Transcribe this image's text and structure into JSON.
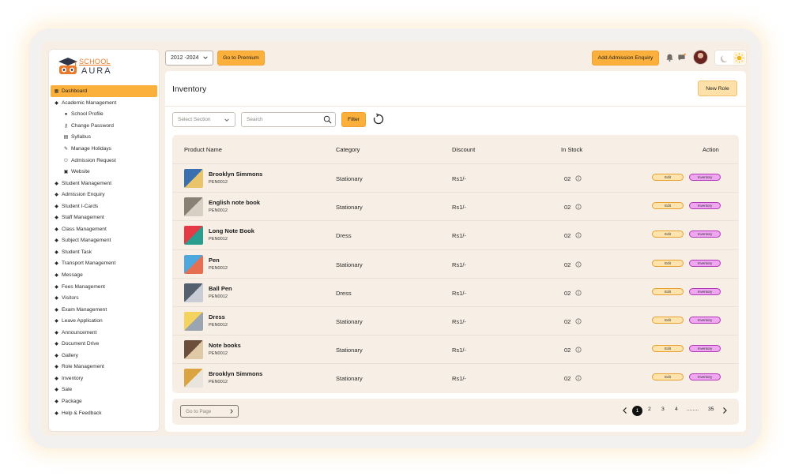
{
  "logo": {
    "line1": "SCHOOL",
    "line2": "AURA"
  },
  "sidebar": {
    "items": [
      {
        "label": "Dashboard",
        "icon": "dashboard-icon",
        "active": true
      },
      {
        "label": "Academic Management",
        "icon": "cap-icon"
      },
      {
        "label": "School Profile",
        "icon": "profile-icon",
        "sub": true
      },
      {
        "label": "Change Password",
        "icon": "key-icon",
        "sub": true
      },
      {
        "label": "Syllabus",
        "icon": "book-icon",
        "sub": true
      },
      {
        "label": "Manage Holidays",
        "icon": "pencil-icon",
        "sub": true
      },
      {
        "label": "Admission Request",
        "icon": "users-icon",
        "sub": true
      },
      {
        "label": "Website",
        "icon": "web-icon",
        "sub": true
      },
      {
        "label": "Student Management",
        "icon": "cap-icon"
      },
      {
        "label": "Admission Enquiry",
        "icon": "cap-icon"
      },
      {
        "label": "Student I-Cards",
        "icon": "cap-icon"
      },
      {
        "label": "Staff Management",
        "icon": "cap-icon"
      },
      {
        "label": "Class Management",
        "icon": "cap-icon"
      },
      {
        "label": "Subject Management",
        "icon": "cap-icon"
      },
      {
        "label": "Student Task",
        "icon": "cap-icon"
      },
      {
        "label": "Transport Management",
        "icon": "cap-icon"
      },
      {
        "label": "Message",
        "icon": "cap-icon"
      },
      {
        "label": "Fees Management",
        "icon": "cap-icon"
      },
      {
        "label": "Visitors",
        "icon": "cap-icon"
      },
      {
        "label": "Exam Management",
        "icon": "cap-icon"
      },
      {
        "label": "Leave Application",
        "icon": "cap-icon"
      },
      {
        "label": "Announcement",
        "icon": "cap-icon"
      },
      {
        "label": "Document Drive",
        "icon": "cap-icon"
      },
      {
        "label": "Gallery",
        "icon": "cap-icon"
      },
      {
        "label": "Role Management",
        "icon": "cap-icon"
      },
      {
        "label": "Inventory",
        "icon": "cap-icon"
      },
      {
        "label": "Sale",
        "icon": "cap-icon"
      },
      {
        "label": "Package",
        "icon": "cap-icon"
      },
      {
        "label": "Help & Feedback",
        "icon": "cap-icon"
      }
    ]
  },
  "topbar": {
    "year": "2012 -2024",
    "premium_label": "Go to Premium",
    "admission_label": "Add Admission Enquiry"
  },
  "page": {
    "title": "Inventory",
    "new_role_label": "New Role",
    "select_placeholder": "Select Section",
    "search_placeholder": "Search",
    "filter_label": "Filter"
  },
  "table": {
    "headers": [
      "Product Name",
      "Category",
      "Discount",
      "In Stock",
      "Action"
    ],
    "edit_label": "Edit",
    "inventory_label": "Inventory",
    "rows": [
      {
        "name": "Brooklyn Simmons",
        "code": "PEN0012",
        "category": "Stationary",
        "discount": "Rs1/-",
        "stock": "02",
        "thumb": [
          "#3a6fb0",
          "#e9c46a"
        ]
      },
      {
        "name": "English note book",
        "code": "PEN0012",
        "category": "Stationary",
        "discount": "Rs1/-",
        "stock": "02",
        "thumb": [
          "#8a7f73",
          "#d8cfc4"
        ]
      },
      {
        "name": "Long Note Book",
        "code": "PEN0012",
        "category": "Dress",
        "discount": "Rs1/-",
        "stock": "02",
        "thumb": [
          "#e63946",
          "#2a9d8f"
        ]
      },
      {
        "name": "Pen",
        "code": "PEN0012",
        "category": "Stationary",
        "discount": "Rs1/-",
        "stock": "02",
        "thumb": [
          "#4ea8de",
          "#e76f51"
        ]
      },
      {
        "name": "Ball Pen",
        "code": "PEN0012",
        "category": "Dress",
        "discount": "Rs1/-",
        "stock": "02",
        "thumb": [
          "#55606e",
          "#c9ced6"
        ]
      },
      {
        "name": "Dress",
        "code": "PEN0012",
        "category": "Stationary",
        "discount": "Rs1/-",
        "stock": "02",
        "thumb": [
          "#f4d35e",
          "#9aa5b1"
        ]
      },
      {
        "name": "Note books",
        "code": "PEN0012",
        "category": "Stationary",
        "discount": "Rs1/-",
        "stock": "02",
        "thumb": [
          "#6b4f3a",
          "#e0c9a6"
        ]
      },
      {
        "name": "Brooklyn Simmons",
        "code": "PEN0012",
        "category": "Stationary",
        "discount": "Rs1/-",
        "stock": "02",
        "thumb": [
          "#d9a441",
          "#e9e4dd"
        ]
      }
    ]
  },
  "pagination": {
    "goto_placeholder": "Go to Page",
    "pages": [
      "1",
      "2",
      "3",
      "4",
      "........",
      "35"
    ],
    "active": "1"
  },
  "colors": {
    "accent": "#fbb03b",
    "inventory_badge": "#efa7f2",
    "panel": "#f7efe6"
  }
}
